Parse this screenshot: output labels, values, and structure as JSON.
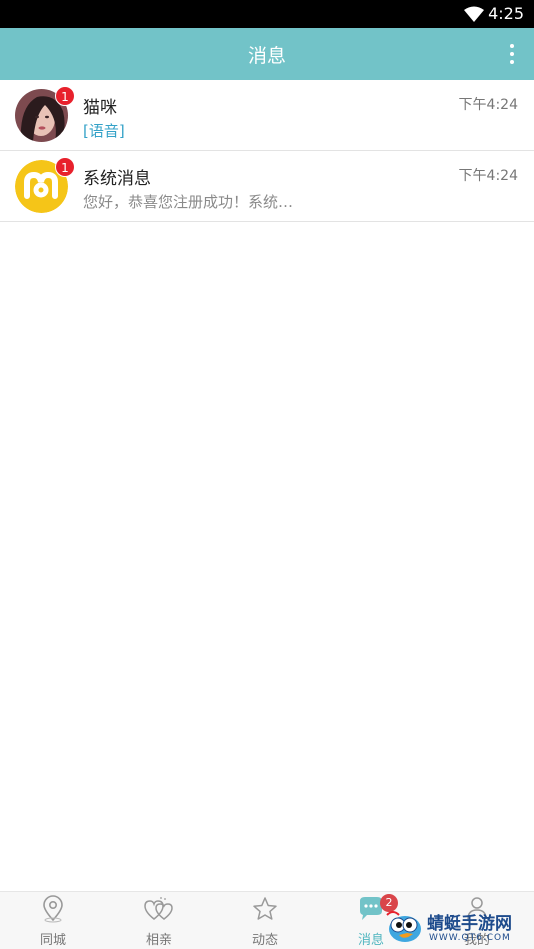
{
  "status_bar": {
    "time": "4:25"
  },
  "app_bar": {
    "title": "消息"
  },
  "conversations": [
    {
      "name": "猫咪",
      "preview": "[语音]",
      "time": "下午4:24",
      "unread": "1"
    },
    {
      "name": "系统消息",
      "preview": "您好，恭喜您注册成功！系统…",
      "time": "下午4:24",
      "unread": "1"
    }
  ],
  "tabs": [
    {
      "label": "同城",
      "icon": "location-pin-icon"
    },
    {
      "label": "相亲",
      "icon": "hearts-icon"
    },
    {
      "label": "动态",
      "icon": "star-icon"
    },
    {
      "label": "消息",
      "icon": "chat-bubble-icon",
      "badge": "2",
      "active": true
    },
    {
      "label": "我的",
      "icon": "person-icon"
    }
  ],
  "watermark": {
    "text": "蜻蜓手游网",
    "sub": "WWW.QT6.COM"
  },
  "colors": {
    "accent": "#72c3c8",
    "badge": "#e8212c",
    "active_tab": "#4fb5bf",
    "voice_link": "#35a2c8"
  }
}
